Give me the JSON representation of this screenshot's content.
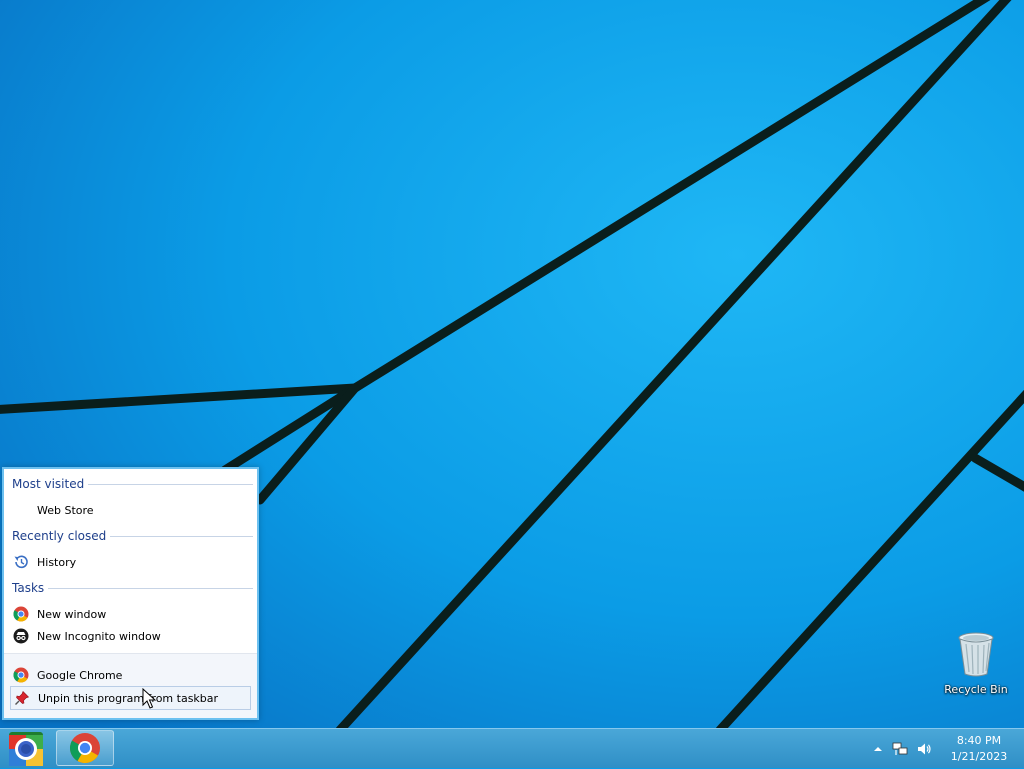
{
  "desktop": {
    "icons": [
      {
        "label": "Recycle Bin",
        "icon": "recycle-bin-icon"
      }
    ]
  },
  "jumplist": {
    "sections": [
      {
        "header": "Most visited",
        "items": [
          {
            "label": "Web Store",
            "icon": null
          }
        ]
      },
      {
        "header": "Recently closed",
        "items": [
          {
            "label": "History",
            "icon": "history-icon"
          }
        ]
      },
      {
        "header": "Tasks",
        "items": [
          {
            "label": "New window",
            "icon": "chrome-icon"
          },
          {
            "label": "New Incognito window",
            "icon": "incognito-icon"
          }
        ]
      }
    ],
    "footer": [
      {
        "label": "Google Chrome",
        "icon": "chrome-icon"
      },
      {
        "label": "Unpin this program from taskbar",
        "icon": "unpin-icon"
      }
    ]
  },
  "taskbar": {
    "pinned": [
      {
        "name": "Google Chrome",
        "icon": "chrome-icon"
      }
    ],
    "tray": {
      "icons": [
        "show-hidden-icons",
        "network-icon",
        "volume-icon"
      ]
    },
    "clock": {
      "time": "8:40 PM",
      "date": "1/21/2023"
    }
  },
  "colors": {
    "wallpaper": "#0a9be8",
    "accent": "#1e3f8b",
    "taskbar": "#3a9bd0"
  }
}
